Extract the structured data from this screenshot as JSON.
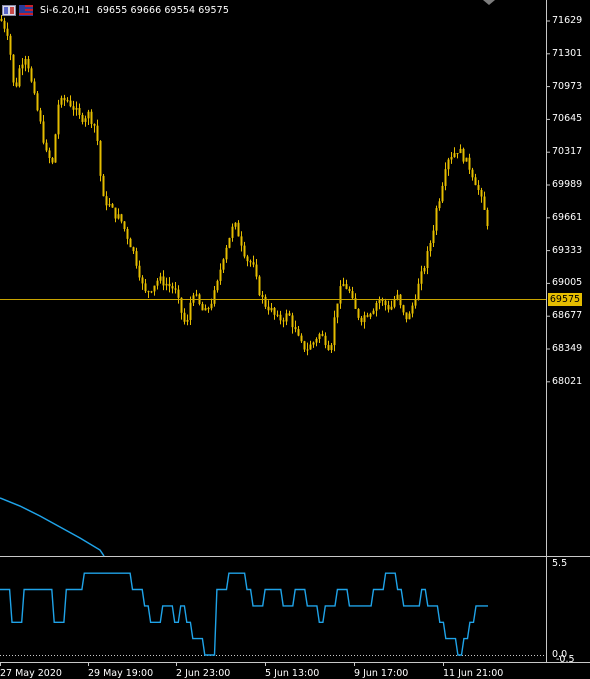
{
  "header": {
    "symbol": "Si-6.20,H1",
    "ohlc": "69655 69666 69554 69575",
    "icons": [
      "window-icon",
      "flag-icon"
    ]
  },
  "colors": {
    "background": "#000000",
    "candle": "#e5bd00",
    "price_line": "#c9a400",
    "indicator": "#1fa3e8",
    "axis_line": "#c8c8c8"
  },
  "price_axis": [
    "71629",
    "71301",
    "70973",
    "70645",
    "70317",
    "69989",
    "69661",
    "69333",
    "69005",
    "68677",
    "68349",
    "68021"
  ],
  "current_price": "69575",
  "indicator_axis": [
    "5.5",
    "0.0",
    "-0.5"
  ],
  "time_axis": [
    "27 May 2020",
    "29 May 19:00",
    "2 Jun 23:00",
    "5 Jun 13:00",
    "9 Jun 17:00",
    "11 Jun 21:00"
  ],
  "chart_data": {
    "type": "candlestick",
    "ylim": [
      67900,
      71750
    ],
    "price_path": [
      [
        0,
        71650
      ],
      [
        8,
        71500
      ],
      [
        14,
        70900
      ],
      [
        20,
        71200
      ],
      [
        26,
        71300
      ],
      [
        32,
        70950
      ],
      [
        40,
        70600
      ],
      [
        46,
        70300
      ],
      [
        52,
        70200
      ],
      [
        58,
        70800
      ],
      [
        66,
        70850
      ],
      [
        74,
        70750
      ],
      [
        80,
        70650
      ],
      [
        88,
        70700
      ],
      [
        96,
        70550
      ],
      [
        102,
        69850
      ],
      [
        108,
        69800
      ],
      [
        114,
        69700
      ],
      [
        120,
        69650
      ],
      [
        126,
        69500
      ],
      [
        132,
        69350
      ],
      [
        138,
        69150
      ],
      [
        144,
        68900
      ],
      [
        150,
        68950
      ],
      [
        158,
        69050
      ],
      [
        166,
        69000
      ],
      [
        174,
        68950
      ],
      [
        180,
        68750
      ],
      [
        186,
        68550
      ],
      [
        192,
        68950
      ],
      [
        198,
        68800
      ],
      [
        204,
        68700
      ],
      [
        210,
        68800
      ],
      [
        216,
        68950
      ],
      [
        222,
        69250
      ],
      [
        228,
        69450
      ],
      [
        234,
        69600
      ],
      [
        240,
        69450
      ],
      [
        246,
        69250
      ],
      [
        252,
        69200
      ],
      [
        258,
        68950
      ],
      [
        264,
        68800
      ],
      [
        270,
        68750
      ],
      [
        276,
        68650
      ],
      [
        282,
        68650
      ],
      [
        288,
        68700
      ],
      [
        294,
        68550
      ],
      [
        300,
        68400
      ],
      [
        306,
        68350
      ],
      [
        312,
        68400
      ],
      [
        318,
        68500
      ],
      [
        324,
        68450
      ],
      [
        330,
        68350
      ],
      [
        336,
        68800
      ],
      [
        342,
        69000
      ],
      [
        348,
        68950
      ],
      [
        354,
        68750
      ],
      [
        360,
        68650
      ],
      [
        366,
        68700
      ],
      [
        372,
        68750
      ],
      [
        378,
        68850
      ],
      [
        384,
        68800
      ],
      [
        390,
        68750
      ],
      [
        396,
        68900
      ],
      [
        402,
        68700
      ],
      [
        408,
        68650
      ],
      [
        414,
        68850
      ],
      [
        420,
        69050
      ],
      [
        426,
        69250
      ],
      [
        432,
        69500
      ],
      [
        436,
        69750
      ],
      [
        440,
        69900
      ],
      [
        446,
        70250
      ],
      [
        452,
        70300
      ],
      [
        458,
        70350
      ],
      [
        464,
        70250
      ],
      [
        470,
        70150
      ],
      [
        476,
        70000
      ],
      [
        482,
        69800
      ],
      [
        488,
        69575
      ]
    ],
    "indicator_series": [
      4,
      4,
      2,
      2,
      4,
      4,
      4,
      4,
      4,
      2,
      2,
      4,
      4,
      4,
      5,
      5,
      5,
      5,
      5,
      5,
      5,
      5,
      4,
      4,
      3,
      2,
      2,
      3,
      3,
      2,
      3,
      2,
      1,
      1,
      0,
      0,
      4,
      4,
      5,
      5,
      5,
      4,
      3,
      3,
      4,
      4,
      4,
      3,
      3,
      4,
      4,
      3,
      3,
      2,
      3,
      3,
      4,
      4,
      3,
      3,
      3,
      3,
      4,
      4,
      5,
      5,
      4,
      3,
      3,
      3,
      4,
      3,
      3,
      2,
      1,
      1,
      0,
      1,
      2,
      3,
      3,
      3
    ]
  }
}
